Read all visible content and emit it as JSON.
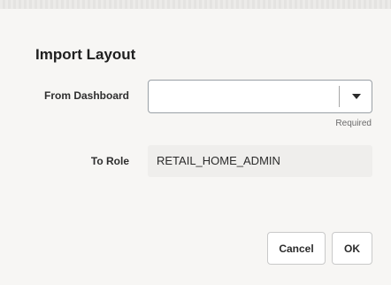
{
  "dialog": {
    "title": "Import Layout"
  },
  "form": {
    "from_dashboard": {
      "label": "From Dashboard",
      "value": "",
      "hint": "Required",
      "icon": "chevron-down-icon"
    },
    "to_role": {
      "label": "To Role",
      "value": "RETAIL_HOME_ADMIN"
    }
  },
  "actions": {
    "cancel_label": "Cancel",
    "ok_label": "OK"
  }
}
